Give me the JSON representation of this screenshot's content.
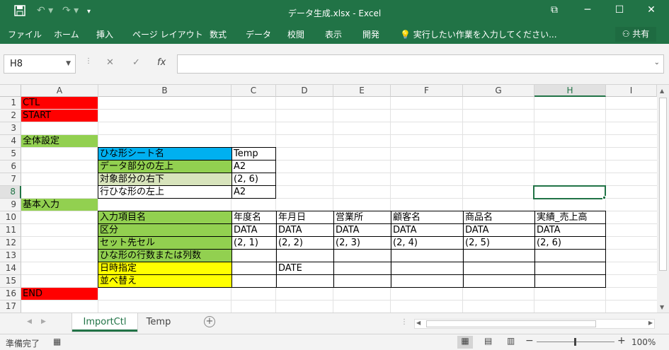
{
  "window": {
    "title": "データ生成.xlsx - Excel",
    "save_icon": "save-icon",
    "minimize": "─",
    "maximize": "☐",
    "close": "✕",
    "ribbon_display": "⧉"
  },
  "ribbon": {
    "tabs": [
      "ファイル",
      "ホーム",
      "挿入",
      "ページ レイアウト",
      "数式",
      "データ",
      "校閲",
      "表示",
      "開発"
    ],
    "tell_me": "実行したい作業を入力してください...",
    "share_label": "共有"
  },
  "formula_bar": {
    "name_box": "H8",
    "cancel": "✕",
    "enter": "✓",
    "fx": "fx",
    "value": ""
  },
  "columns": [
    "A",
    "B",
    "C",
    "D",
    "E",
    "F",
    "G",
    "H",
    "I"
  ],
  "rows": [
    "1",
    "2",
    "3",
    "4",
    "5",
    "6",
    "7",
    "8",
    "9",
    "10",
    "11",
    "12",
    "13",
    "14",
    "15",
    "16",
    "17"
  ],
  "cells": {
    "A1": "CTL",
    "A2": "START",
    "A4": "全体設定",
    "B5": "ひな形シート名",
    "C5": "Temp",
    "B6": "データ部分の左上",
    "C6": "A2",
    "B7": "対象部分の右下",
    "C7": "(2, 6)",
    "B8": "行ひな形の左上",
    "C8": "A2",
    "A9": "基本入力",
    "B10": "入力項目名",
    "C10": "年度名",
    "D10": "年月日",
    "E10": "営業所",
    "F10": "顧客名",
    "G10": "商品名",
    "H10": "実績_売上高",
    "B11": "区分",
    "C11": "DATA",
    "D11": "DATA",
    "E11": "DATA",
    "F11": "DATA",
    "G11": "DATA",
    "H11": "DATA",
    "B12": "セット先セル",
    "C12": "(2, 1)",
    "D12": "(2, 2)",
    "E12": "(2, 3)",
    "F12": "(2, 4)",
    "G12": "(2, 5)",
    "H12": "(2, 6)",
    "B13": "ひな形の行数または列数",
    "B14": "日時指定",
    "D14": "DATE",
    "B15": "並べ替え",
    "A16": "END"
  },
  "sheet_tabs": [
    "ImportCtl",
    "Temp"
  ],
  "active_sheet": "ImportCtl",
  "status": {
    "ready": "準備完了",
    "zoom": "100%"
  },
  "colors": {
    "excel_green": "#217346",
    "red": "#ff0000",
    "green": "#92d050",
    "blue": "#00b0f0",
    "light_green": "#d8e4bc",
    "yellow": "#ffff00"
  }
}
